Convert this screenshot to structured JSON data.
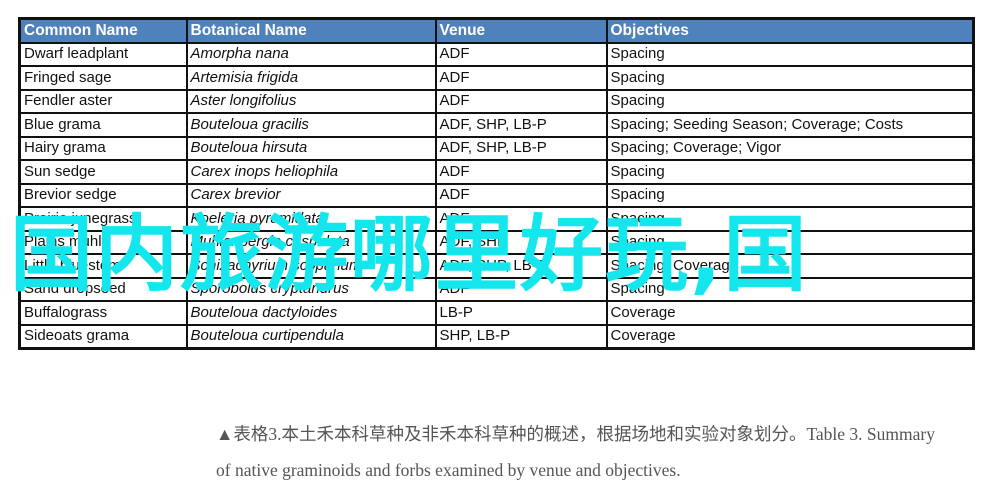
{
  "table": {
    "headers": [
      "Common Name",
      "Botanical  Name",
      "Venue",
      "Objectives"
    ],
    "rows": [
      {
        "common": "Dwarf leadplant",
        "botanical": "Amorpha nana",
        "venue": "ADF",
        "objectives": "Spacing"
      },
      {
        "common": "Fringed sage",
        "botanical": "Artemisia frigida",
        "venue": "ADF",
        "objectives": "Spacing"
      },
      {
        "common": "Fendler aster",
        "botanical": "Aster longifolius",
        "venue": "ADF",
        "objectives": "Spacing"
      },
      {
        "common": "Blue grama",
        "botanical": "Bouteloua gracilis",
        "venue": "ADF, SHP, LB-P",
        "objectives": "Spacing; Seeding Season;  Coverage; Costs"
      },
      {
        "common": "Hairy grama",
        "botanical": "Bouteloua hirsuta",
        "venue": "ADF, SHP, LB-P",
        "objectives": "Spacing; Coverage; Vigor"
      },
      {
        "common": "Sun sedge",
        "botanical": "Carex inops heliophila",
        "venue": "ADF",
        "objectives": "Spacing"
      },
      {
        "common": "Brevior sedge",
        "botanical": "Carex brevior",
        "venue": "ADF",
        "objectives": "Spacing"
      },
      {
        "common": "Prairie junegrass",
        "botanical": "Koeleria pyramidata",
        "venue": "ADF",
        "objectives": "Spacing"
      },
      {
        "common": "Plains muhly",
        "botanical": "Muhlenbergia cuspidata",
        "venue": "ADF, SHP",
        "objectives": "Spacing"
      },
      {
        "common": "Little bluestem",
        "botanical": "Schizachyrium scoparium",
        "venue": "ADF, SHP, LB-P",
        "objectives": "Spacing; Coverage"
      },
      {
        "common": "Sand dropseed",
        "botanical": "Sporobolus cryptandrus",
        "venue": "ADF",
        "objectives": "Spacing"
      },
      {
        "common": "Buffalograss",
        "botanical": "Bouteloua dactyloides",
        "venue": "LB-P",
        "objectives": "Coverage"
      },
      {
        "common": "Sideoats grama",
        "botanical": "Bouteloua curtipendula",
        "venue": "SHP, LB-P",
        "objectives": "Coverage"
      }
    ]
  },
  "overlay_text": "国内旅游哪里好玩,国",
  "caption": {
    "line1": "▲表格3.本土禾本科草种及非禾本科草种的概述，根据场地和实验对象划分。Table 3. Summary",
    "line2": "of native graminoids and forbs examined by venue and objectives."
  },
  "colors": {
    "header_bg": "#4f81bd",
    "overlay": "#14e6ee"
  }
}
